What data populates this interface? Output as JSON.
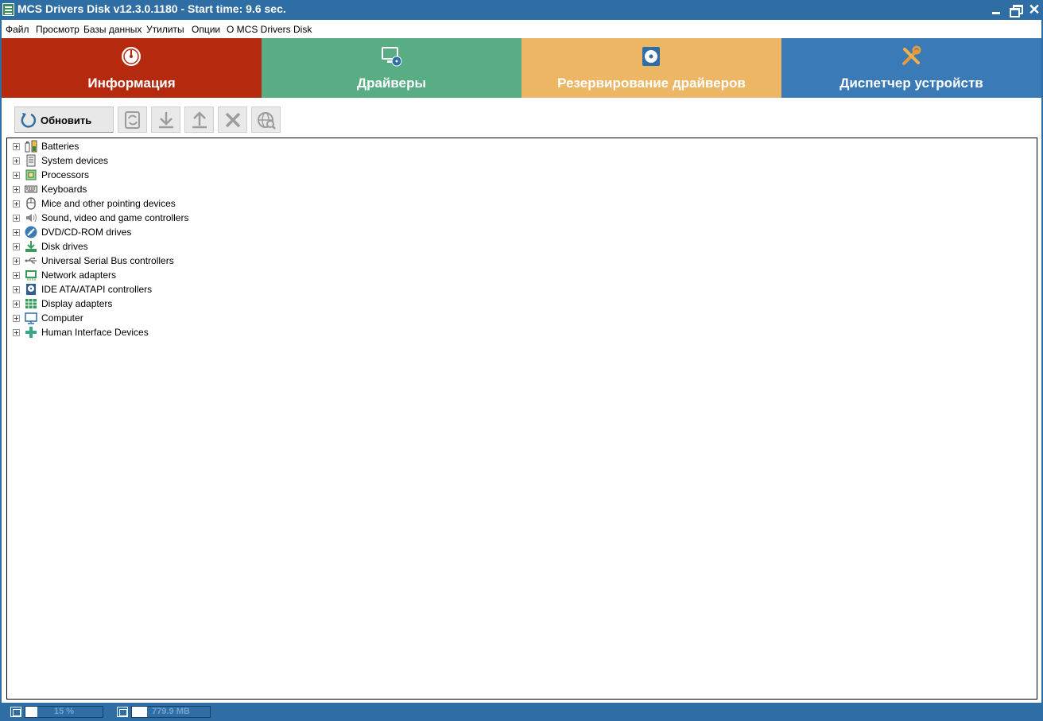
{
  "window": {
    "title": "MCS Drivers Disk v12.3.0.1180 - Start time: 9.6 sec.",
    "controls": {
      "minimize": "",
      "maximize": "",
      "close": "✕"
    }
  },
  "menu": [
    "Файл",
    "Просмотр",
    "Базы данных",
    "Утилиты",
    "Опции",
    "О MCS Drivers Disk"
  ],
  "tabs": [
    {
      "label": "Информация",
      "icon": "gauge-icon",
      "color": "#b52a0f"
    },
    {
      "label": "Драйверы",
      "icon": "monitor-disc-icon",
      "color": "#58ad85"
    },
    {
      "label": "Резервирование драйверов",
      "icon": "disk-backup-icon",
      "color": "#ecb664"
    },
    {
      "label": "Диспетчер устройств",
      "icon": "tools-icon",
      "color": "#3a7ab7"
    }
  ],
  "toolbar": {
    "refresh_label": "Обновить",
    "buttons": [
      "update-driver-icon",
      "download-icon",
      "upload-icon",
      "remove-icon",
      "web-search-icon"
    ]
  },
  "device_tree": [
    {
      "label": "Batteries",
      "icon": "battery-icon"
    },
    {
      "label": "System devices",
      "icon": "system-device-icon"
    },
    {
      "label": "Processors",
      "icon": "processor-icon"
    },
    {
      "label": "Keyboards",
      "icon": "keyboard-icon"
    },
    {
      "label": "Mice and other pointing devices",
      "icon": "mouse-icon"
    },
    {
      "label": "Sound, video and game controllers",
      "icon": "speaker-icon"
    },
    {
      "label": "DVD/CD-ROM drives",
      "icon": "dvd-icon"
    },
    {
      "label": "Disk drives",
      "icon": "disk-drive-icon"
    },
    {
      "label": "Universal Serial Bus controllers",
      "icon": "usb-icon"
    },
    {
      "label": "Network adapters",
      "icon": "network-adapter-icon"
    },
    {
      "label": "IDE ATA/ATAPI controllers",
      "icon": "ide-controller-icon"
    },
    {
      "label": "Display adapters",
      "icon": "display-adapter-icon"
    },
    {
      "label": "Computer",
      "icon": "computer-icon"
    },
    {
      "label": "Human Interface Devices",
      "icon": "hid-icon"
    }
  ],
  "status": {
    "cpu": {
      "text": "15 %",
      "fill": 0.15,
      "icon": "cpu-icon"
    },
    "memory": {
      "text": "779.9 MB",
      "fill": 0.19,
      "icon": "memory-icon"
    }
  },
  "colors": {
    "titlebar": "#2f6ea5",
    "accent_blue": "#3a7ab7"
  }
}
